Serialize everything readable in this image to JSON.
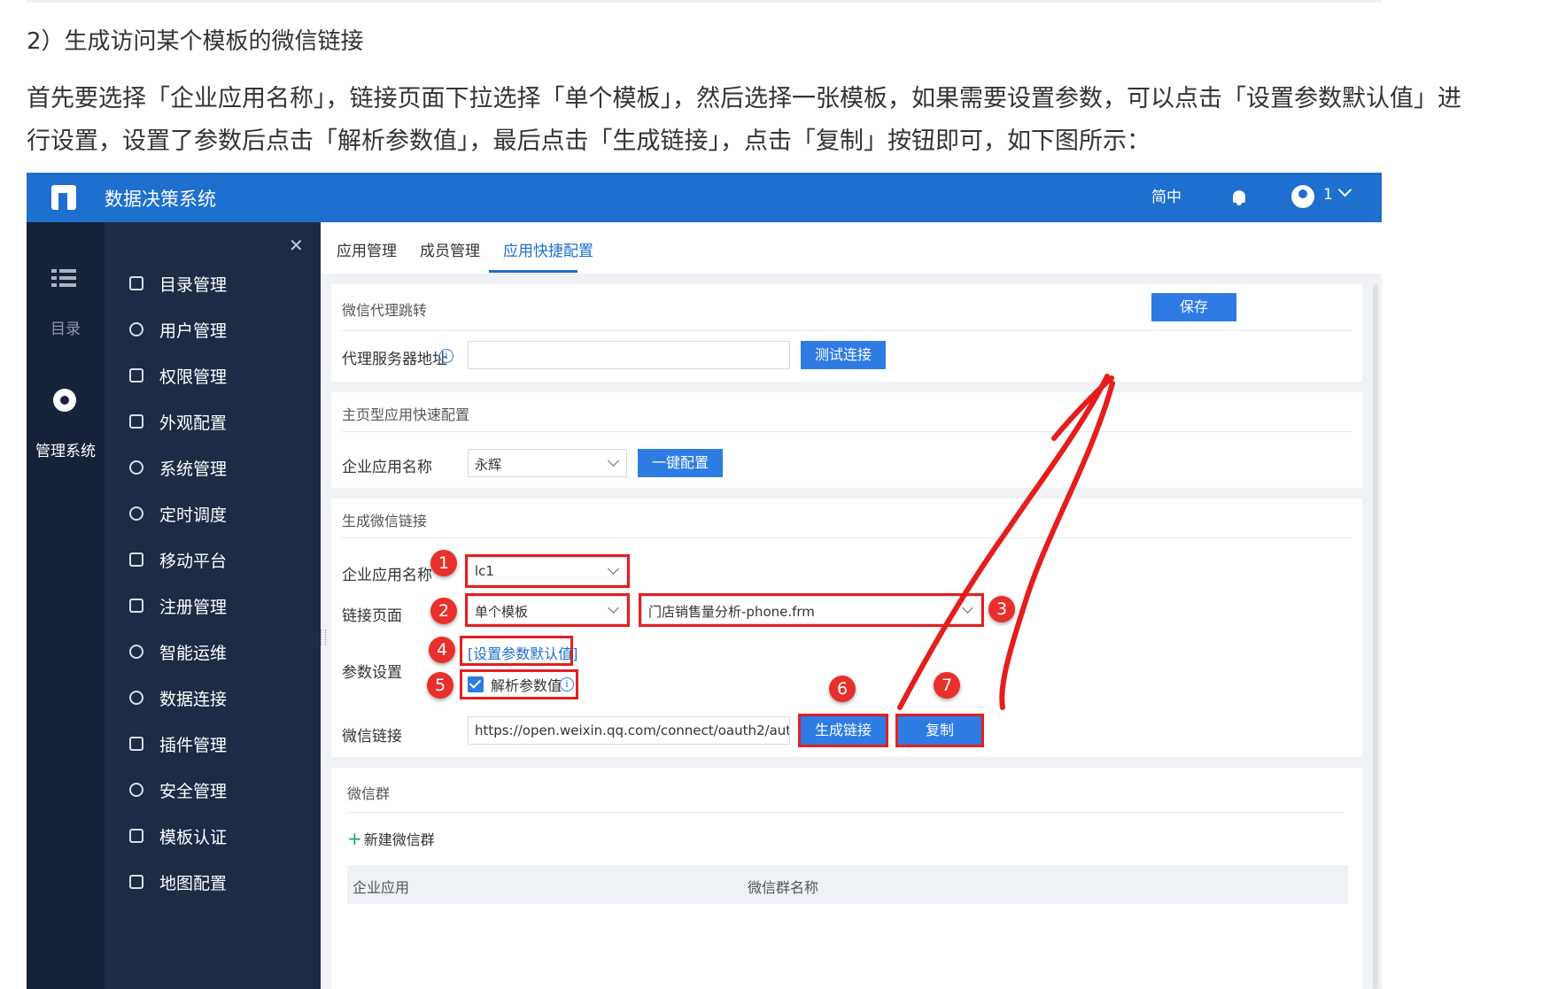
{
  "doc": {
    "heading": "2）生成访问某个模板的微信链接",
    "paragraph": "首先要选择「企业应用名称」，链接页面下拉选择「单个模板」，然后选择一张模板，如果需要设置参数，可以点击「设置参数默认值」进行设置，设置了参数后点击「解析参数值」，最后点击「生成链接」，点击「复制」按钮即可，如下图所示："
  },
  "topbar": {
    "title": "数据决策系统",
    "lang": "简中",
    "user": "1"
  },
  "rail": {
    "dir_label": "目录",
    "mgmt_label": "管理系统"
  },
  "sidebar": {
    "items": [
      {
        "label": "目录管理",
        "icon": "directory-icon"
      },
      {
        "label": "用户管理",
        "icon": "user-icon"
      },
      {
        "label": "权限管理",
        "icon": "lock-icon"
      },
      {
        "label": "外观配置",
        "icon": "paint-roller-icon"
      },
      {
        "label": "系统管理",
        "icon": "gear-icon"
      },
      {
        "label": "定时调度",
        "icon": "clock-icon"
      },
      {
        "label": "移动平台",
        "icon": "mobile-icon"
      },
      {
        "label": "注册管理",
        "icon": "register-icon"
      },
      {
        "label": "智能运维",
        "icon": "ops-icon"
      },
      {
        "label": "数据连接",
        "icon": "link-icon"
      },
      {
        "label": "插件管理",
        "icon": "plugin-icon"
      },
      {
        "label": "安全管理",
        "icon": "shield-icon"
      },
      {
        "label": "模板认证",
        "icon": "template-cert-icon"
      },
      {
        "label": "地图配置",
        "icon": "map-icon"
      }
    ]
  },
  "tabs": [
    {
      "label": "应用管理"
    },
    {
      "label": "成员管理"
    },
    {
      "label": "应用快捷配置"
    }
  ],
  "proxy": {
    "title": "微信代理跳转",
    "save": "保存",
    "label": "代理服务器地址",
    "value": "",
    "test_button": "测试连接"
  },
  "homepage": {
    "title": "主页型应用快速配置",
    "label": "企业应用名称",
    "selected": "永辉",
    "button": "一键配置"
  },
  "gen": {
    "title": "生成微信链接",
    "app_label": "企业应用名称",
    "app_value": "lc1",
    "page_label": "链接页面",
    "page_value": "单个模板",
    "template_value": "门店销售量分析-phone.frm",
    "param_label": "参数设置",
    "set_default": "[设置参数默认值]",
    "parse_label": "解析参数值",
    "link_label": "微信链接",
    "link_value": "https://open.weixin.qq.com/connect/oauth2/aut...",
    "gen_button": "生成链接",
    "copy_button": "复制"
  },
  "group": {
    "title": "微信群",
    "add": "新建微信群",
    "col1": "企业应用",
    "col2": "微信群名称"
  },
  "markers": [
    "1",
    "2",
    "3",
    "4",
    "5",
    "6",
    "7"
  ],
  "colors": {
    "topbar": "#1e6fce",
    "sidebar": "#1d2b45",
    "rail": "#162238",
    "button": "#2e7be4",
    "annotation": "#e32020"
  }
}
